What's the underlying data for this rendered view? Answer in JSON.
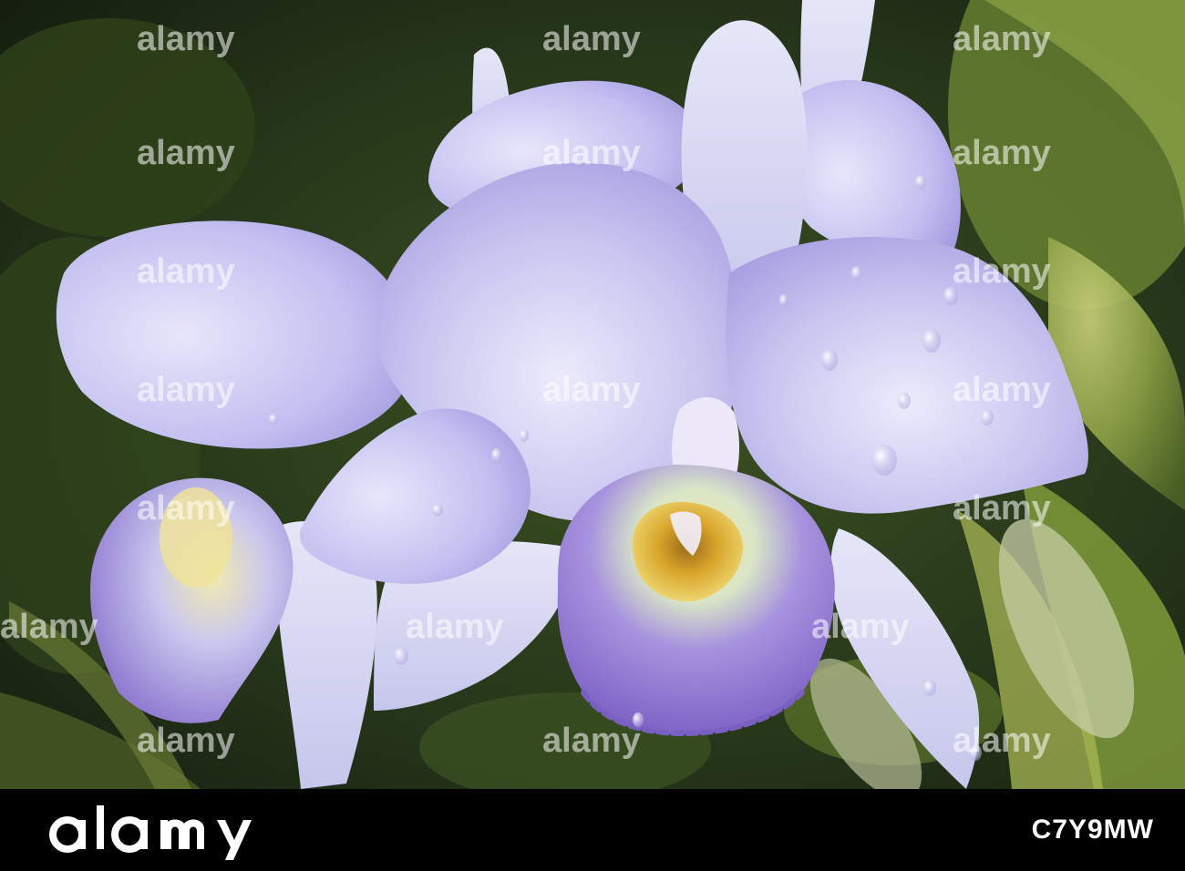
{
  "image": {
    "subject": "orchid",
    "colors": {
      "petal": "#c6c4ee",
      "petal_edge": "#9c8fdb",
      "lip_purple": "#8d72cf",
      "throat_yellow": "#e1b02c",
      "foliage": "#4f6b2a",
      "background_dark": "#1a2512",
      "footer": "#000000"
    }
  },
  "watermark": {
    "brand": "alamy"
  },
  "footer": {
    "image_id": "C7Y9MW"
  }
}
